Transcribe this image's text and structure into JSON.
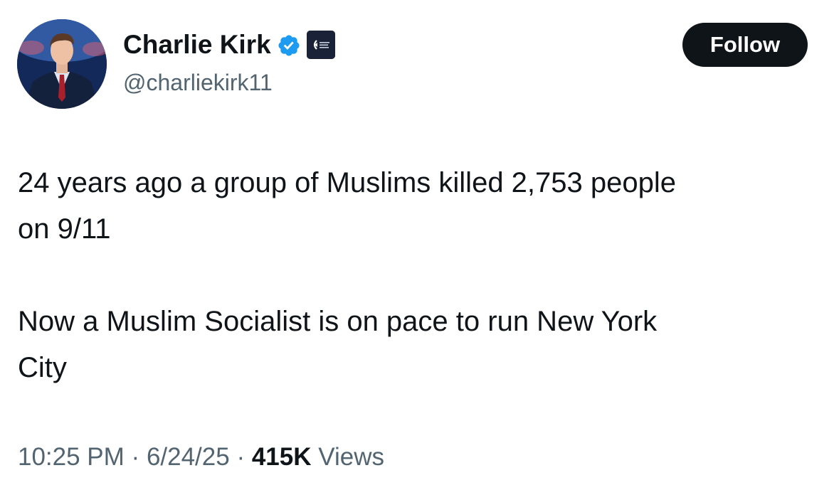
{
  "author": {
    "display_name": "Charlie Kirk",
    "handle": "@charliekirk11",
    "verified_icon": "verified-badge-icon",
    "affiliate_badge_icon": "organization-affiliate-icon",
    "avatar": "profile-photo"
  },
  "follow_button": {
    "label": "Follow"
  },
  "tweet": {
    "paragraphs": [
      "24 years ago a group of Muslims killed 2,753 people\non 9/11",
      "Now a Muslim Socialist is on pace to run New York\nCity"
    ]
  },
  "meta": {
    "time": "10:25 PM",
    "separator": "·",
    "date": "6/24/25",
    "views_count": "415K",
    "views_label": "Views"
  },
  "colors": {
    "text_primary": "#0f1419",
    "text_secondary": "#536471",
    "verified_blue": "#1d9bf0",
    "button_bg": "#0f1419"
  }
}
